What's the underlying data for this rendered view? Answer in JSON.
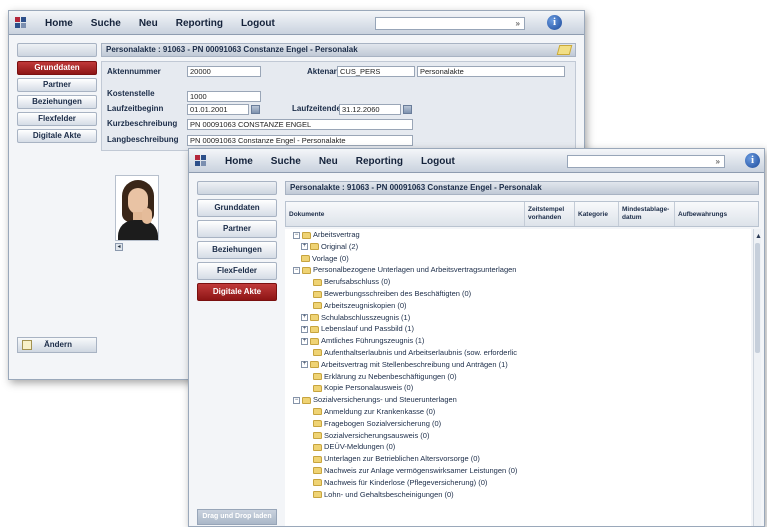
{
  "back": {
    "menu": [
      "Home",
      "Suche",
      "Neu",
      "Reporting",
      "Logout"
    ],
    "search": {
      "go": "»"
    },
    "info": "i",
    "sidebar": [
      "Grunddaten",
      "Partner",
      "Beziehungen",
      "Flexfelder",
      "Digitale Akte"
    ],
    "header": "Personalakte : 91063 - PN 00091063 Constanze Engel - Personalak",
    "form": {
      "aktennummer_label": "Aktennummer",
      "aktennummer_value": "20000",
      "aktenart_label": "Aktenart",
      "aktenart_code": "CUS_PERS",
      "aktenart_value": "Personalakte",
      "kostenstelle_label": "Kostenstelle",
      "kostenstelle_value": "1000",
      "laufzeitbeginn_label": "Laufzeitbeginn",
      "laufzeitbeginn_value": "01.01.2001",
      "laufzeitende_label": "Laufzeitende",
      "laufzeitende_value": "31.12.2060",
      "kurz_label": "Kurzbeschreibung",
      "kurz_value": "PN 00091063 CONSTANZE ENGEL",
      "lang_label": "Langbeschreibung",
      "lang_value": "PN 00091063 Constanze Engel - Personalakte"
    },
    "aendern": "Ändern"
  },
  "front": {
    "menu": [
      "Home",
      "Suche",
      "Neu",
      "Reporting",
      "Logout"
    ],
    "search": {
      "go": "»"
    },
    "info": "i",
    "sidebar": [
      "Grunddaten",
      "Partner",
      "Beziehungen",
      "FlexFelder",
      "Digitale Akte"
    ],
    "header": "Personalakte : 91063 - PN 00091063 Constanze Engel - Personalak",
    "columns": [
      "Dokumente",
      "Zeitstempel vorhanden",
      "Kategorie",
      "Mindestablage-datum",
      "Aufbewahrungs"
    ],
    "tree": [
      {
        "level": 0,
        "toggle": "−",
        "label": "Arbeitsvertrag"
      },
      {
        "level": 1,
        "toggle": "+",
        "label": "Original (2)"
      },
      {
        "level": 1,
        "toggle": "",
        "label": "Vorlage (0)"
      },
      {
        "level": 0,
        "toggle": "−",
        "label": "Personalbezogene Unterlagen und Arbeitsvertragsunterlagen"
      },
      {
        "level": 2,
        "toggle": "",
        "label": "Berufsabschluss (0)"
      },
      {
        "level": 2,
        "toggle": "",
        "label": "Bewerbungsschreiben des Beschäftigten (0)"
      },
      {
        "level": 2,
        "toggle": "",
        "label": "Arbeitszeugniskopien (0)"
      },
      {
        "level": 1,
        "toggle": "+",
        "label": "Schulabschlusszeugnis (1)"
      },
      {
        "level": 1,
        "toggle": "+",
        "label": "Lebenslauf und Passbild (1)"
      },
      {
        "level": 1,
        "toggle": "+",
        "label": "Amtliches Führungszeugnis (1)"
      },
      {
        "level": 2,
        "toggle": "",
        "label": "Aufenthaltserlaubnis und Arbeitserlaubnis (sow. erforderlic"
      },
      {
        "level": 1,
        "toggle": "+",
        "label": "Arbeitsvertrag mit Stellenbeschreibung und Anträgen (1)"
      },
      {
        "level": 2,
        "toggle": "",
        "label": "Erklärung zu Nebenbeschäftigungen (0)"
      },
      {
        "level": 2,
        "toggle": "",
        "label": "Kopie Personalausweis (0)"
      },
      {
        "level": 0,
        "toggle": "−",
        "label": "Sozialversicherungs- und Steuerunterlagen"
      },
      {
        "level": 2,
        "toggle": "",
        "label": "Anmeldung zur Krankenkasse (0)"
      },
      {
        "level": 2,
        "toggle": "",
        "label": "Fragebogen Sozialversicherung (0)"
      },
      {
        "level": 2,
        "toggle": "",
        "label": "Sozialversicherungsausweis (0)"
      },
      {
        "level": 2,
        "toggle": "",
        "label": "DEÜV-Meldungen (0)"
      },
      {
        "level": 2,
        "toggle": "",
        "label": "Unterlagen zur Betrieblichen Altersvorsorge (0)"
      },
      {
        "level": 2,
        "toggle": "",
        "label": "Nachweis zur Anlage vermögenswirksamer Leistungen (0)"
      },
      {
        "level": 2,
        "toggle": "",
        "label": "Nachweis für Kinderlose (Pflegeversicherung) (0)"
      },
      {
        "level": 2,
        "toggle": "",
        "label": "Lohn- und Gehaltsbescheinigungen (0)"
      }
    ],
    "dragdrop": "Drag und Drop laden"
  }
}
